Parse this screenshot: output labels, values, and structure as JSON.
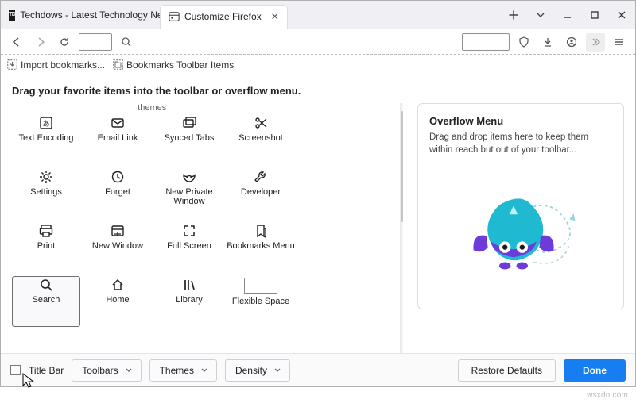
{
  "tabs": [
    {
      "label": "Techdows - Latest Technology News"
    },
    {
      "label": "Customize Firefox"
    }
  ],
  "bookmarks_bar": {
    "import": "Import bookmarks...",
    "folder": "Bookmarks Toolbar Items"
  },
  "instruction": "Drag your favorite items into the toolbar or overflow menu.",
  "row_hint": {
    "themes": "themes"
  },
  "palette": [
    {
      "name": "text-encoding",
      "label": "Text Encoding",
      "icon": "encoding"
    },
    {
      "name": "email-link",
      "label": "Email Link",
      "icon": "mail"
    },
    {
      "name": "synced-tabs",
      "label": "Synced Tabs",
      "icon": "tabs"
    },
    {
      "name": "screenshot",
      "label": "Screenshot",
      "icon": "scissors"
    },
    {
      "name": "settings",
      "label": "Settings",
      "icon": "gear"
    },
    {
      "name": "forget",
      "label": "Forget",
      "icon": "forget"
    },
    {
      "name": "new-private-window",
      "label": "New Private Window",
      "icon": "mask"
    },
    {
      "name": "developer",
      "label": "Developer",
      "icon": "wrench"
    },
    {
      "name": "print",
      "label": "Print",
      "icon": "print"
    },
    {
      "name": "new-window",
      "label": "New Window",
      "icon": "window"
    },
    {
      "name": "full-screen",
      "label": "Full Screen",
      "icon": "fullscreen"
    },
    {
      "name": "bookmarks-menu",
      "label": "Bookmarks Menu",
      "icon": "bookmarks"
    },
    {
      "name": "search",
      "label": "Search",
      "icon": "search",
      "selected": true
    },
    {
      "name": "home",
      "label": "Home",
      "icon": "home"
    },
    {
      "name": "library",
      "label": "Library",
      "icon": "library"
    },
    {
      "name": "flexible-space",
      "label": "Flexible Space",
      "icon": "flex"
    }
  ],
  "overflow": {
    "title": "Overflow Menu",
    "desc": "Drag and drop items here to keep them within reach but out of your toolbar..."
  },
  "footer": {
    "titlebar": "Title Bar",
    "toolbars": "Toolbars",
    "themes": "Themes",
    "density": "Density",
    "restore": "Restore Defaults",
    "done": "Done"
  },
  "watermark": "wsxdn.com"
}
